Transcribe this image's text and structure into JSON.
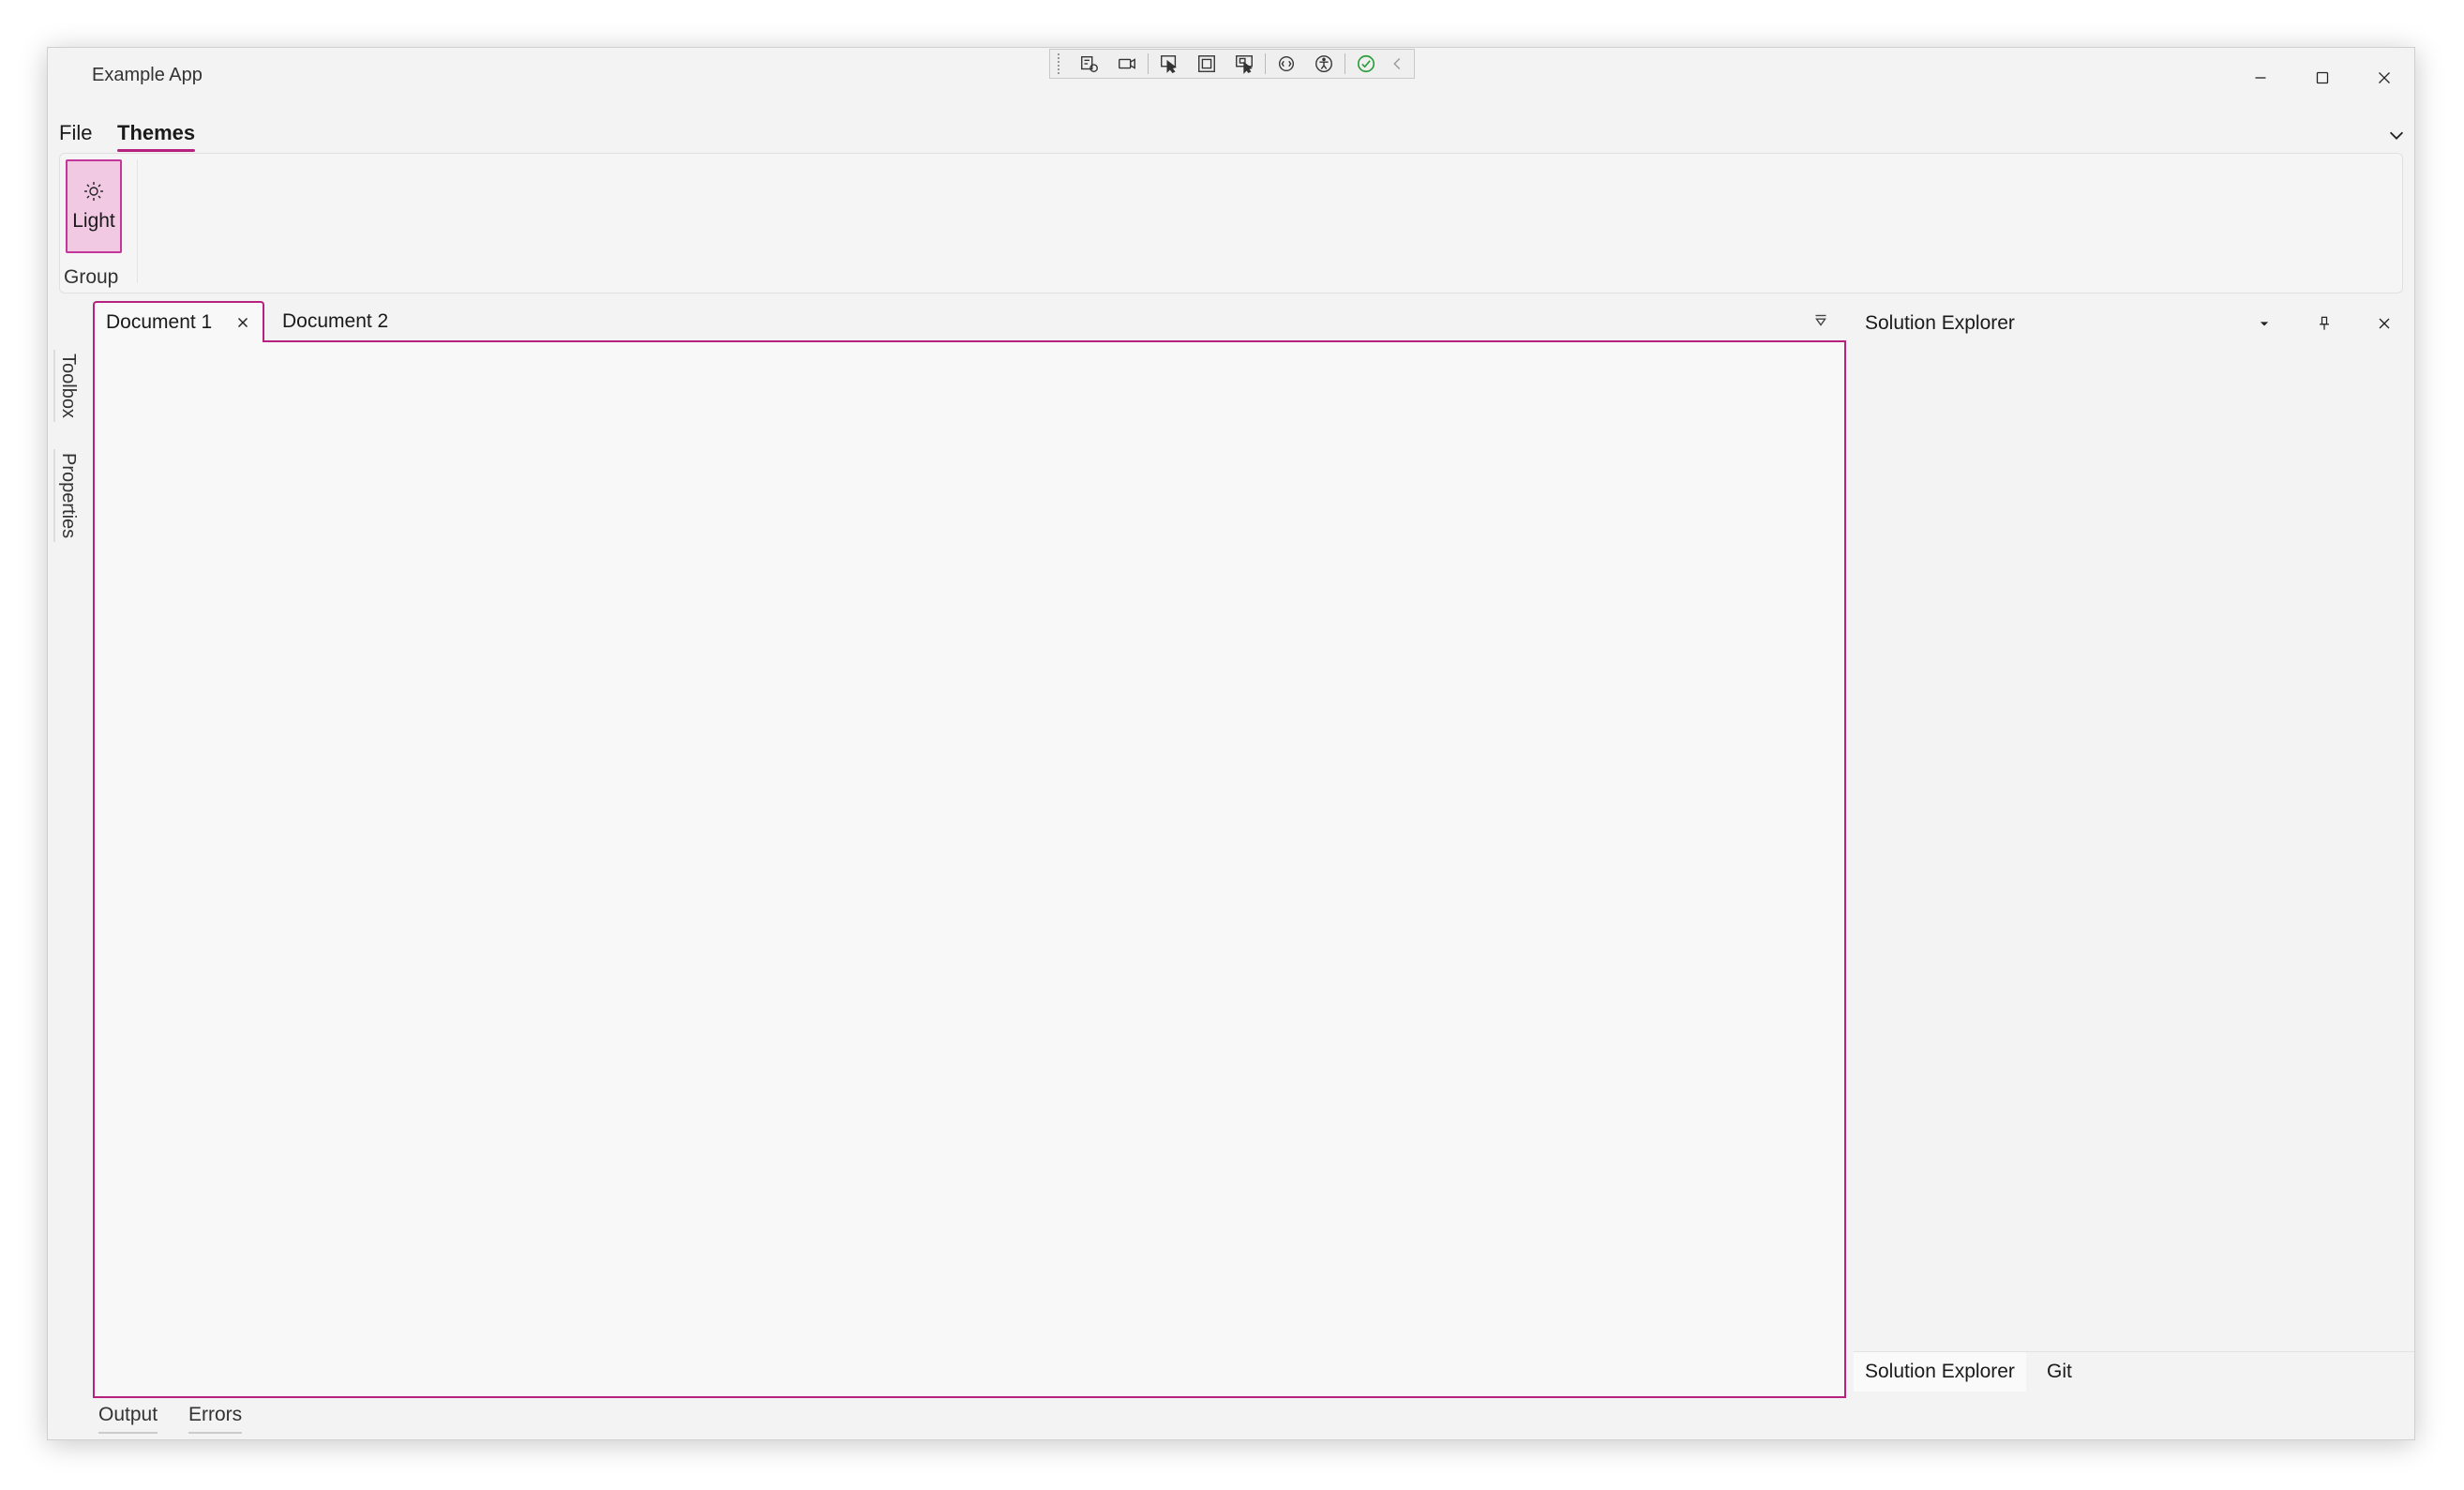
{
  "window": {
    "title": "Example App"
  },
  "devtools": {
    "icons": [
      "live-tree-icon",
      "record-icon",
      "select-element-icon",
      "display-layout-adorners-icon",
      "track-focus-icon",
      "binding-failures-icon",
      "accessibility-icon",
      "checkmark-icon",
      "collapse-chevron-icon"
    ]
  },
  "menu": {
    "items": [
      "File",
      "Themes"
    ],
    "active": "Themes"
  },
  "ribbon": {
    "button_label": "Light",
    "group_label": "Group"
  },
  "side_tabs": [
    "Toolbox",
    "Properties"
  ],
  "documents": {
    "tabs": [
      "Document 1",
      "Document 2"
    ],
    "active": "Document 1"
  },
  "bottom_tabs": [
    "Output",
    "Errors"
  ],
  "panel": {
    "title": "Solution Explorer",
    "tabs": [
      "Solution Explorer",
      "Git"
    ],
    "active": "Solution Explorer"
  },
  "colors": {
    "accent": "#b8227f",
    "accent_fill": "#f1c9e3",
    "window_bg": "#f3f3f3",
    "content_bg": "#f8f8f8"
  }
}
